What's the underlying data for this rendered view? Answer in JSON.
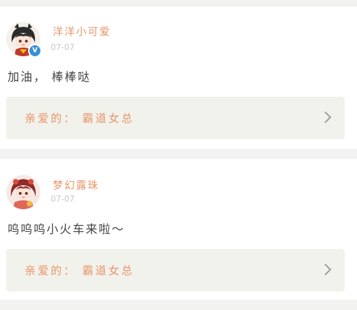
{
  "comments": [
    {
      "username": "洋洋小可爱",
      "date": "07-07",
      "text": "加油， 棒棒哒",
      "verified": true,
      "verified_glyph": "V",
      "avatar_icon": "anime-girl-avatar",
      "reply": "亲爱的： 霸道女总"
    },
    {
      "username": "梦幻露珠",
      "date": "07-07",
      "text": "呜呜呜小火车来啦～",
      "verified": false,
      "avatar_icon": "anime-girl-red-avatar",
      "reply": "亲爱的： 霸道女总"
    }
  ],
  "colors": {
    "username": "#e8956a",
    "reply_text": "#e8956a",
    "reply_bg": "#f2f2ec",
    "verified_badge": "#3a8fd8"
  }
}
